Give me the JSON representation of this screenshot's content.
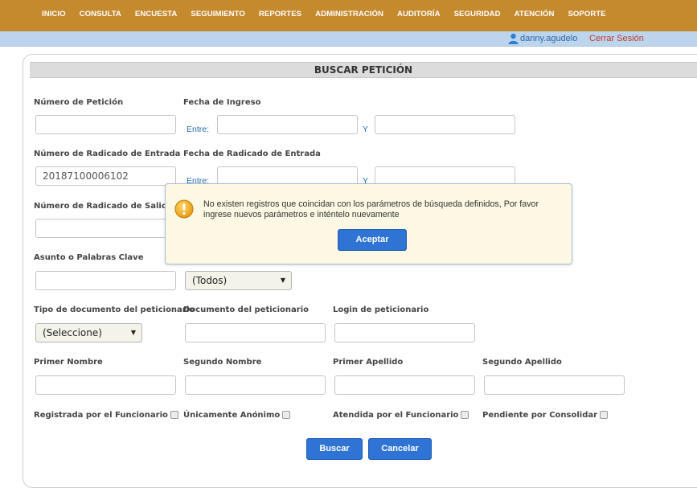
{
  "nav": {
    "items": [
      "INICIO",
      "CONSULTA",
      "ENCUESTA",
      "SEGUIMIENTO",
      "REPORTES",
      "ADMINISTRACIÓN",
      "AUDITORÍA",
      "SEGURIDAD",
      "ATENCIÓN",
      "SOPORTE"
    ]
  },
  "user": {
    "name": "danny.agudelo",
    "logout": "Cerrar Sesión"
  },
  "title": "BUSCAR PETICIÓN",
  "form": {
    "numero_peticion": {
      "label": "Número de Petición",
      "value": ""
    },
    "fecha_ingreso": {
      "label": "Fecha de Ingreso",
      "entre": "Entre:",
      "y": "Y"
    },
    "radicado_entrada": {
      "label": "Número de Radicado de Entrada",
      "value": "20187100006102"
    },
    "fecha_radicado": {
      "label": "Fecha de Radicado de Entrada",
      "entre": "Entre:",
      "y": "Y"
    },
    "radicado_salida": {
      "label": "Número de Radicado de Salida",
      "value": ""
    },
    "asunto": {
      "label": "Asunto o Palabras Clave",
      "value": ""
    },
    "todos_select": {
      "value": "(Todos)"
    },
    "tipo_doc": {
      "label": "Tipo de documento del peticionario",
      "value": "(Seleccione)"
    },
    "documento": {
      "label": "Documento del peticionario",
      "value": ""
    },
    "login": {
      "label": "Login de peticionario",
      "value": ""
    },
    "primer_nombre": {
      "label": "Primer Nombre",
      "value": ""
    },
    "segundo_nombre": {
      "label": "Segundo Nombre",
      "value": ""
    },
    "primer_apellido": {
      "label": "Primer Apellido",
      "value": ""
    },
    "segundo_apellido": {
      "label": "Segundo Apellido",
      "value": ""
    },
    "chk_registrada": {
      "label": "Registrada por el Funcionario"
    },
    "chk_anonimo": {
      "label": "Únicamente Anónimo"
    },
    "chk_atendida": {
      "label": "Atendida por el Funcionario"
    },
    "chk_pendiente": {
      "label": "Pendiente por Consolidar"
    }
  },
  "buttons": {
    "buscar": "Buscar",
    "cancelar": "Cancelar"
  },
  "dialog": {
    "message": "No existen registros que coincidan con los parámetros de búsqueda definidos, Por favor ingrese nuevos parámetros e inténtelo nuevamente",
    "accept": "Aceptar"
  },
  "colors": {
    "nav_bg": "#c58a2e",
    "userbar_bg": "#bcd5ec",
    "button_blue": "#2f73d5",
    "dialog_bg": "#fcf8e3"
  }
}
